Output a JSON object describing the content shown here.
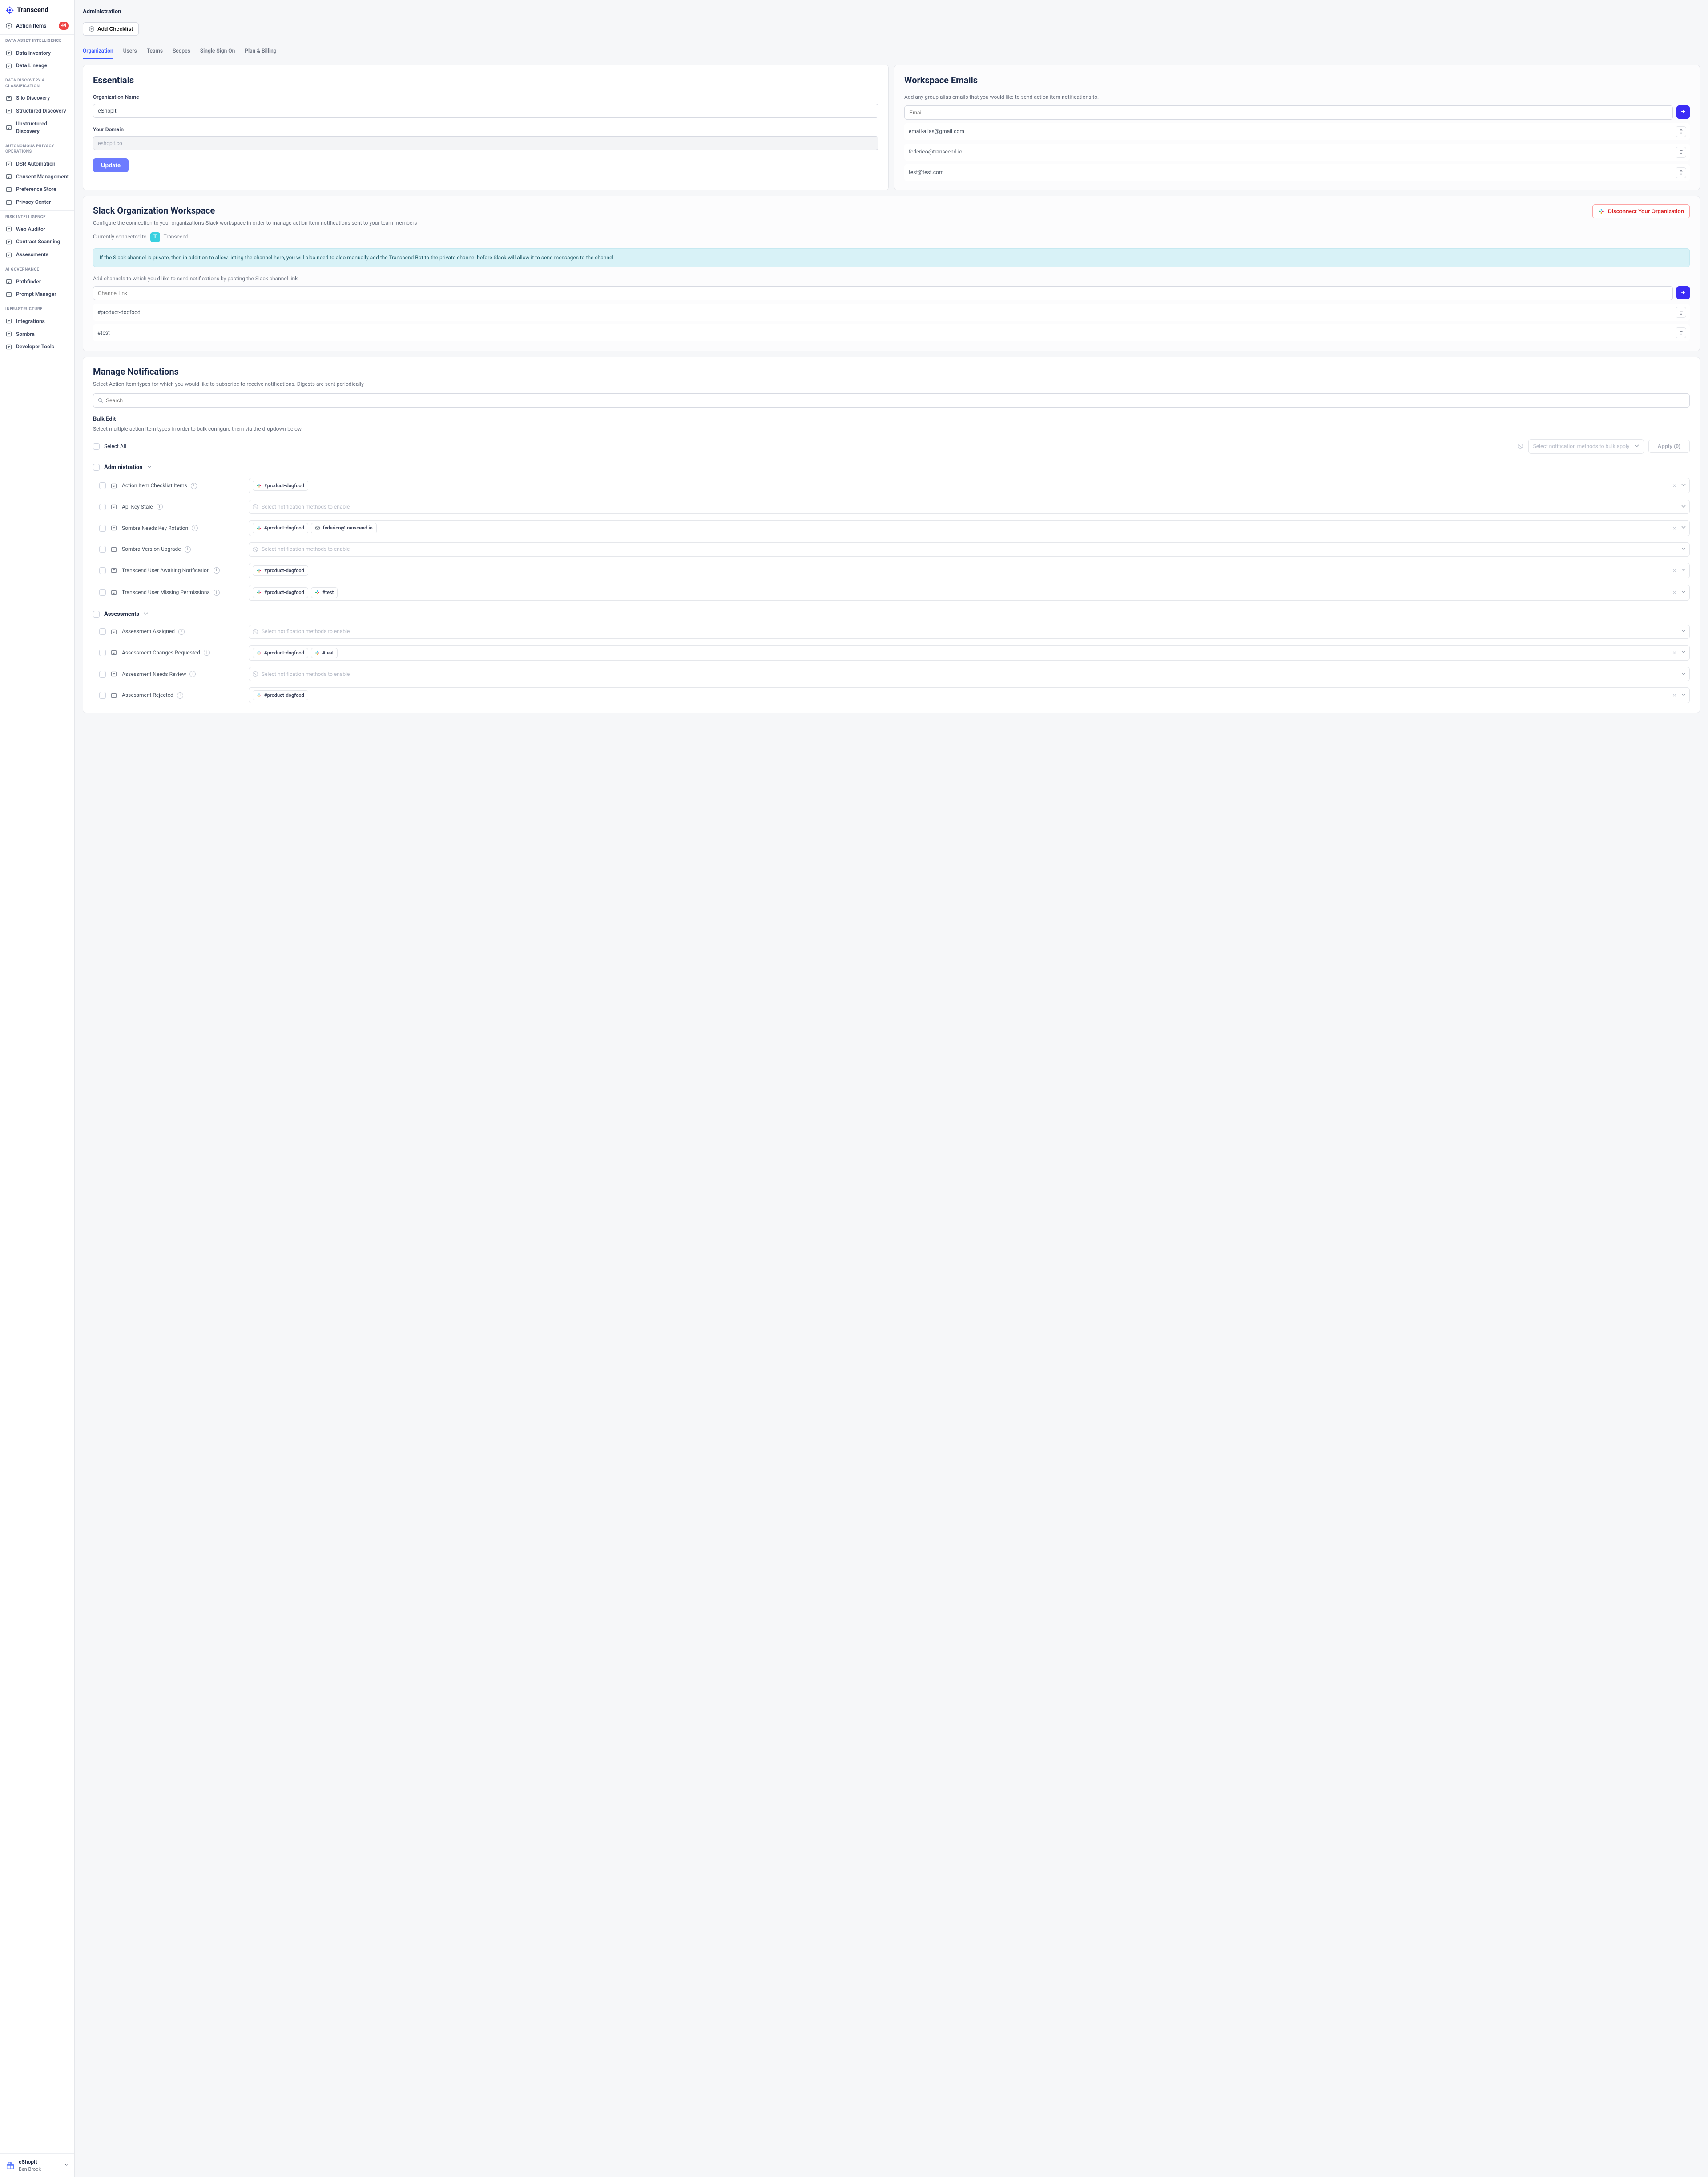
{
  "brand": {
    "name": "Transcend"
  },
  "action_items": {
    "label": "Action Items",
    "count": "44"
  },
  "side_groups": [
    {
      "title": "DATA ASSET INTELLIGENCE",
      "items": [
        "Data Inventory",
        "Data Lineage"
      ]
    },
    {
      "title": "DATA DISCOVERY & CLASSIFICATION",
      "items": [
        "Silo Discovery",
        "Structured Discovery",
        "Unstructured Discovery"
      ]
    },
    {
      "title": "AUTONOMOUS PRIVACY OPERATIONS",
      "items": [
        "DSR Automation",
        "Consent Management",
        "Preference Store",
        "Privacy Center"
      ]
    },
    {
      "title": "RISK INTELLIGENCE",
      "items": [
        "Web Auditor",
        "Contract Scanning",
        "Assessments"
      ]
    },
    {
      "title": "AI GOVERNANCE",
      "items": [
        "Pathfinder",
        "Prompt Manager"
      ]
    },
    {
      "title": "INFRASTRUCTURE",
      "items": [
        "Integrations",
        "Sombra",
        "Developer Tools"
      ]
    }
  ],
  "footer": {
    "org": "eShopIt",
    "user": "Ben Brook"
  },
  "page": {
    "title": "Administration",
    "add_checklist": "Add Checklist"
  },
  "tabs": [
    "Organization",
    "Users",
    "Teams",
    "Scopes",
    "Single Sign On",
    "Plan & Billing"
  ],
  "tabs_active_index": 0,
  "essentials": {
    "title": "Essentials",
    "org_label": "Organization Name",
    "org_value": "eShopIt",
    "domain_label": "Your Domain",
    "domain_value": "eshopit.co",
    "update": "Update"
  },
  "workspace_emails": {
    "title": "Workspace Emails",
    "desc": "Add any group alias emails that you would like to send action item notifications to.",
    "placeholder": "Email",
    "items": [
      "email-alias@gmail.com",
      "federico@transcend.io",
      "test@test.com"
    ]
  },
  "slack": {
    "title": "Slack Organization Workspace",
    "desc": "Configure the connection to your organization's Slack workspace in order to manage action item notifications sent to your team members",
    "disconnect": "Disconnect Your Organization",
    "connected_prefix": "Currently connected to",
    "workspace_initial": "T",
    "workspace_name": "Transcend",
    "banner": "If the Slack channel is private, then in addition to allow-listing the channel here, you will also need to also manually add the Transcend Bot to the private channel before Slack will allow it to send messages to the channel",
    "add_label": "Add channels to which you'd like to send notifications by pasting the Slack channel link",
    "placeholder": "Channel link",
    "items": [
      "#product-dogfood",
      "#test"
    ]
  },
  "manage": {
    "title": "Manage Notifications",
    "desc": "Select Action Item types for which you would like to subscribe to receive notifications. Digests are sent periodically",
    "search_placeholder": "Search",
    "bulk_title": "Bulk Edit",
    "bulk_desc": "Select multiple action item types in order to bulk configure them via the dropdown below.",
    "select_all": "Select All",
    "bulk_select_placeholder": "Select notification methods to bulk apply",
    "apply": "Apply  (0)",
    "method_placeholder": "Select notification methods to enable",
    "groups": [
      {
        "name": "Administration",
        "items": [
          {
            "label": "Action Item Checklist Items",
            "tags": [
              {
                "icon": "slack",
                "text": "#product-dogfood"
              }
            ],
            "clearable": true
          },
          {
            "label": "Api Key Stale",
            "placeholder": true,
            "blocked": true
          },
          {
            "label": "Sombra Needs Key Rotation",
            "tags": [
              {
                "icon": "slack",
                "text": "#product-dogfood"
              },
              {
                "icon": "mail",
                "text": "federico@transcend.io"
              }
            ],
            "clearable": true
          },
          {
            "label": "Sombra Version Upgrade",
            "placeholder": true,
            "blocked": true
          },
          {
            "label": "Transcend User Awaiting Notification",
            "tags": [
              {
                "icon": "slack",
                "text": "#product-dogfood"
              }
            ],
            "clearable": true
          },
          {
            "label": "Transcend User Missing Permissions",
            "tags": [
              {
                "icon": "slack",
                "text": "#product-dogfood"
              },
              {
                "icon": "slack",
                "text": "#test"
              }
            ],
            "clearable": true
          }
        ]
      },
      {
        "name": "Assessments",
        "items": [
          {
            "label": "Assessment Assigned",
            "placeholder": true,
            "blocked": true
          },
          {
            "label": "Assessment Changes Requested",
            "tags": [
              {
                "icon": "slack",
                "text": "#product-dogfood"
              },
              {
                "icon": "slack",
                "text": "#test"
              }
            ],
            "clearable": true
          },
          {
            "label": "Assessment Needs Review",
            "placeholder": true,
            "blocked": true
          },
          {
            "label": "Assessment Rejected",
            "tags": [
              {
                "icon": "slack",
                "text": "#product-dogfood"
              }
            ],
            "clearable": true
          }
        ]
      }
    ]
  },
  "colors": {
    "accent": "#3b5bff"
  }
}
